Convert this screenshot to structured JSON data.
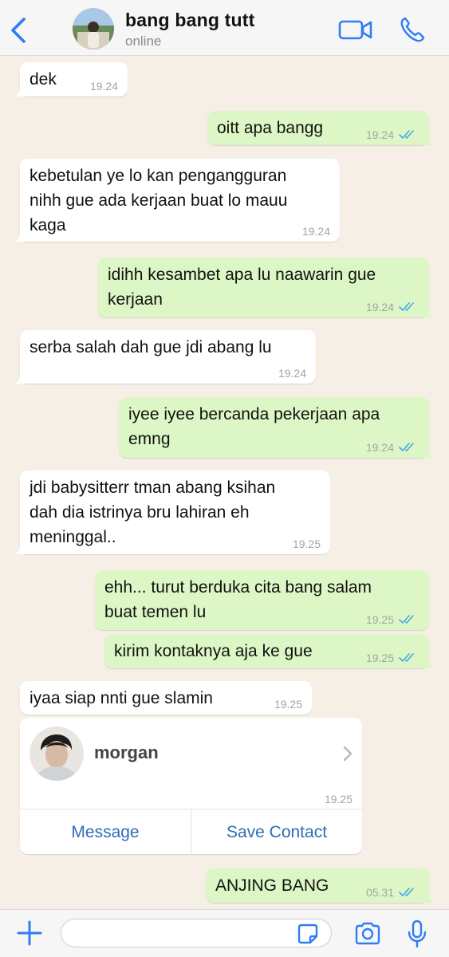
{
  "header": {
    "contact_name": "bang bang tutt",
    "status": "online",
    "icons": {
      "back": "chevron-left-icon",
      "video": "video-call-icon",
      "phone": "phone-call-icon"
    }
  },
  "messages": [
    {
      "dir": "in",
      "lines": [
        "dek"
      ],
      "time": "19.24"
    },
    {
      "dir": "out",
      "lines": [
        "oitt apa bangg"
      ],
      "time": "19.24",
      "read": true
    },
    {
      "dir": "in",
      "lines": [
        "kebetulan ye lo kan pengangguran",
        "nihh gue ada kerjaan buat lo mauu",
        "kaga"
      ],
      "time": "19.24"
    },
    {
      "dir": "out",
      "lines": [
        "idihh kesambet apa lu naawarin gue",
        "kerjaan"
      ],
      "time": "19.24",
      "read": true
    },
    {
      "dir": "in",
      "lines": [
        "serba salah dah gue jdi abang lu"
      ],
      "time": "19.24"
    },
    {
      "dir": "out",
      "lines": [
        "iyee iyee bercanda pekerjaan apa",
        "emng"
      ],
      "time": "19.24",
      "read": true
    },
    {
      "dir": "in",
      "lines": [
        "jdi babysitterr tman abang ksihan",
        "dah dia istrinya bru lahiran eh",
        "meninggal.."
      ],
      "time": "19.25"
    },
    {
      "dir": "out",
      "lines": [
        "ehh... turut berduka cita bang salam",
        "buat temen lu"
      ],
      "time": "19.25",
      "read": true
    },
    {
      "dir": "out",
      "lines": [
        "kirim kontaknya aja ke gue"
      ],
      "time": "19.25",
      "read": true
    },
    {
      "dir": "in",
      "lines": [
        "iyaa siap nnti gue slamin"
      ],
      "time": "19.25"
    },
    {
      "dir": "out",
      "lines": [
        "ANJING BANG"
      ],
      "time": "05.31",
      "read": true
    }
  ],
  "contact_card": {
    "name": "morgan",
    "time": "19.25",
    "message_button": "Message",
    "save_button": "Save Contact"
  },
  "input": {
    "value": "",
    "placeholder": ""
  },
  "colors": {
    "chat_background": "#f5efe6",
    "outgoing_bubble": "#dcf7c5",
    "incoming_bubble": "#ffffff",
    "accent": "#2f7cf6",
    "read_ticks": "#4aa8e6"
  }
}
